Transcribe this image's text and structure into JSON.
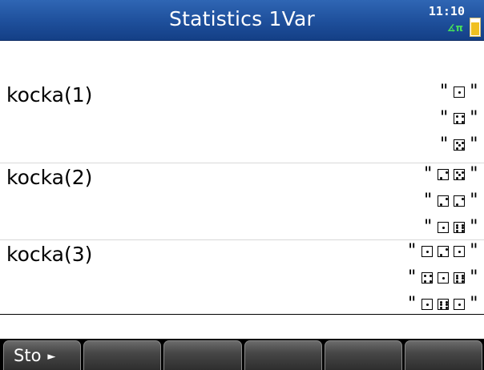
{
  "header": {
    "title": "Statistics 1Var",
    "time": "11:10",
    "angle_mode": "∡π"
  },
  "history": [
    {
      "expression": "kocka(1)",
      "results": [
        [
          1
        ],
        [
          4
        ],
        [
          5
        ]
      ]
    },
    {
      "expression": "kocka(2)",
      "results": [
        [
          2,
          5
        ],
        [
          2,
          2
        ],
        [
          1,
          6
        ]
      ]
    },
    {
      "expression": "kocka(3)",
      "results": [
        [
          1,
          2,
          1
        ],
        [
          4,
          1,
          6
        ],
        [
          1,
          6,
          1
        ]
      ]
    }
  ],
  "menu": {
    "keys": [
      {
        "label": "Sto",
        "icon": "arrow-right-icon"
      },
      {
        "label": ""
      },
      {
        "label": ""
      },
      {
        "label": ""
      },
      {
        "label": ""
      },
      {
        "label": ""
      }
    ]
  },
  "colors": {
    "titlebar": "#1e4f9b",
    "angle_indicator": "#46e05a",
    "menu_key": "#474747"
  }
}
